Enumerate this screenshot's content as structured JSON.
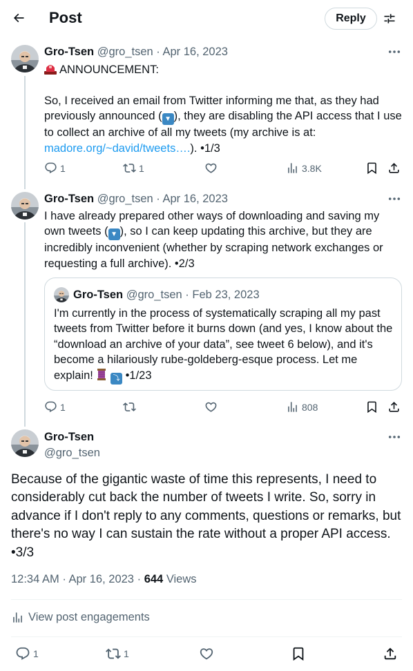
{
  "header": {
    "title": "Post",
    "reply_label": "Reply"
  },
  "tweets": [
    {
      "name": "Gro-Tsen",
      "handle": "@gro_tsen",
      "sep": "·",
      "date": "Apr 16, 2023",
      "line1": "ANNOUNCEMENT:",
      "text_a": "So, I received an email from Twitter informing me that, as they had previously announced (",
      "text_b": "), they are disabling the API access that I use to collect an archive of all my tweets (my archive is at: ",
      "link": "madore.org/~david/tweets….",
      "text_c": "). •1/3",
      "replies": "1",
      "reposts": "1",
      "views": "3.8K"
    },
    {
      "name": "Gro-Tsen",
      "handle": "@gro_tsen",
      "sep": "·",
      "date": "Apr 16, 2023",
      "text_a": "I have already prepared other ways of downloading and saving my own tweets (",
      "text_b": "), so I can keep updating this archive, but they are incredibly inconvenient (whether by scraping network exchanges or requesting a full archive). •2/3",
      "quote": {
        "name": "Gro-Tsen",
        "handle": "@gro_tsen",
        "sep": "·",
        "date": "Feb 23, 2023",
        "text_a": "I'm currently in the process of systematically scraping all my past tweets from Twitter before it burns down (and yes, I know about the “download an archive of your data”, see tweet 6 below), and it's become a hilariously rube-goldeberg-esque process. Let me explain! ",
        "text_b": " •1/23"
      },
      "replies": "1",
      "views": "808"
    }
  ],
  "main_post": {
    "name": "Gro-Tsen",
    "handle": "@gro_tsen",
    "text": "Because of the gigantic waste of time this represents, I need to considerably cut back the number of tweets I write. So, sorry in advance if I don't reply to any comments, questions or remarks, but there's no way I can sustain the rate without a proper API access. •3/3",
    "time": "12:34 AM",
    "sep": "·",
    "date": "Apr 16, 2023",
    "sep2": "·",
    "views_count": "644",
    "views_label": "Views",
    "engagements_label": "View post engagements",
    "replies": "1",
    "reposts": "1"
  },
  "colors": {
    "text": "#0f1419",
    "muted": "#536471",
    "link": "#1d9bf0",
    "border": "#cfd9de",
    "divider": "#eff3f4"
  },
  "icons": [
    "back-arrow-icon",
    "filter-icon",
    "more-icon",
    "reply-icon",
    "repost-icon",
    "like-icon",
    "views-icon",
    "bookmark-icon",
    "share-icon",
    "siren-emoji",
    "down-arrow-emoji",
    "thread-emoji",
    "right-arrow-emoji"
  ]
}
